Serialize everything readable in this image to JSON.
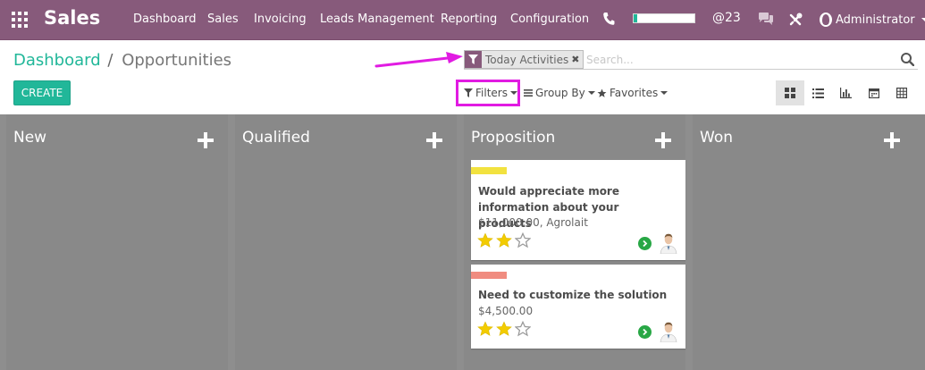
{
  "navbar": {
    "app_title": "Sales",
    "menu": [
      "Dashboard",
      "Sales",
      "Invoicing",
      "Leads Management",
      "Reporting",
      "Configuration"
    ],
    "mentions_count": "23",
    "progress_fraction": 0.06,
    "user_name": "Administrator",
    "colors": {
      "background": "#875a7b",
      "accent": "#21b799"
    }
  },
  "breadcrumb": {
    "parent": "Dashboard",
    "separator": "/",
    "current": "Opportunities"
  },
  "search": {
    "facet_label": "Today Activities",
    "facet_remove": "✖",
    "placeholder": "Search..."
  },
  "toolbar": {
    "create_label": "CREATE",
    "filters_label": "Filters",
    "groupby_label": "Group By",
    "favorites_label": "Favorites",
    "views": [
      "kanban-icon",
      "list-icon",
      "graph-icon",
      "calendar-icon",
      "pivot-icon"
    ],
    "active_view": "kanban-icon"
  },
  "annotations": {
    "highlight_color": "#e11be2"
  },
  "kanban": {
    "columns": [
      {
        "title": "New"
      },
      {
        "title": "Qualified"
      },
      {
        "title": "Proposition"
      },
      {
        "title": "Won"
      }
    ],
    "cards": [
      {
        "title": "Would appreciate more information about your products",
        "subtitle": "$11,000.00, Agrolait",
        "tag_color": "#f2e23f",
        "stars": 2,
        "max_stars": 3
      },
      {
        "title": "Need to customize the solution",
        "subtitle": "$4,500.00",
        "tag_color": "#f08c80",
        "stars": 2,
        "max_stars": 3
      }
    ]
  }
}
